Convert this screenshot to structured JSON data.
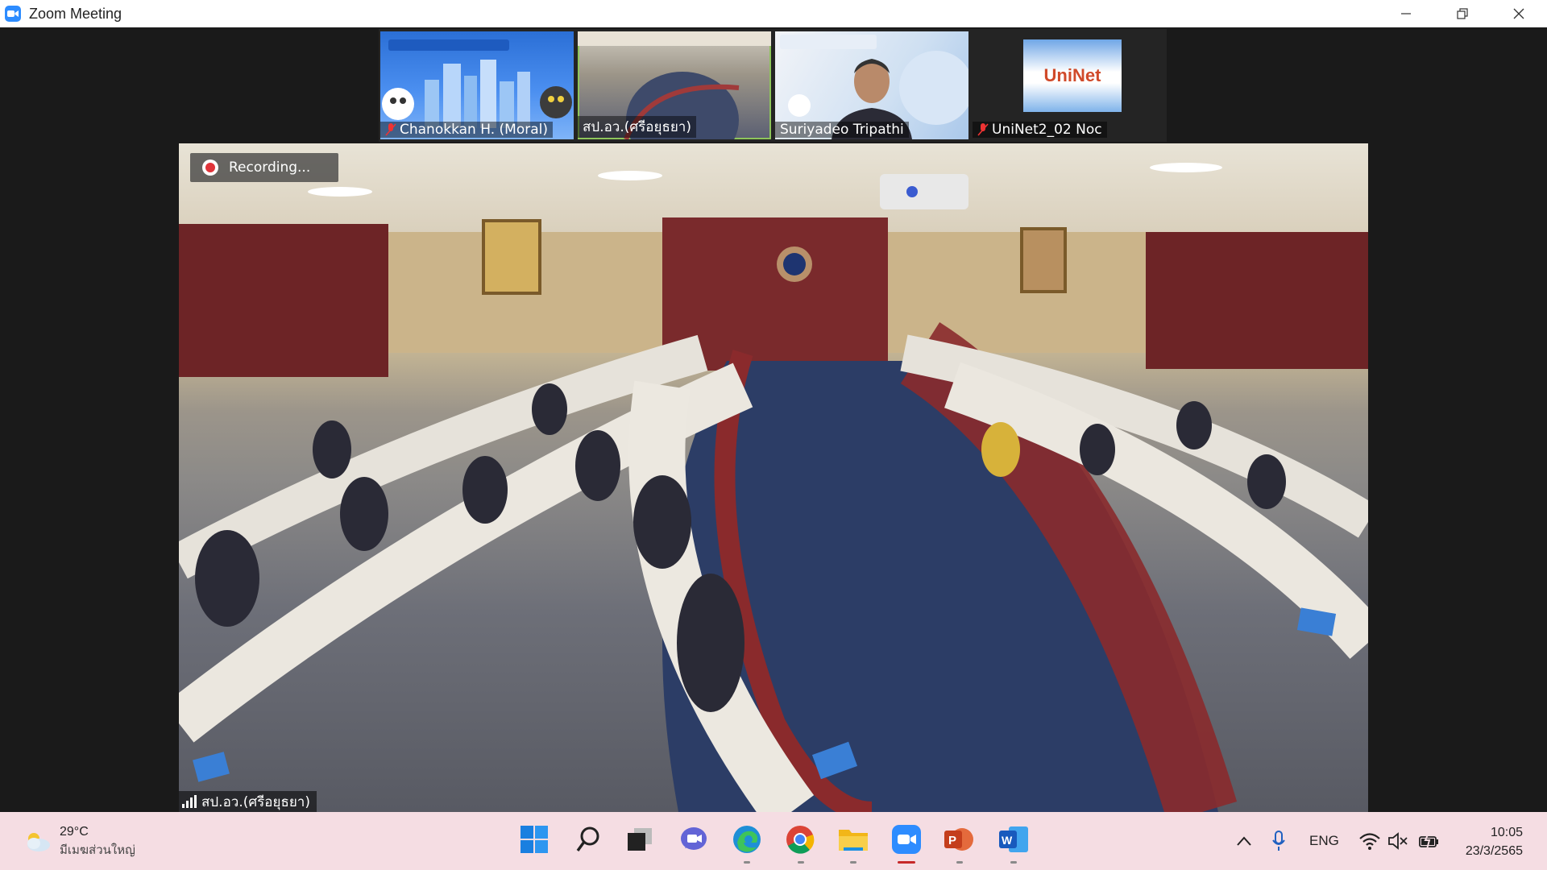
{
  "window": {
    "title": "Zoom Meeting",
    "controls": [
      "minimize",
      "restore",
      "close"
    ]
  },
  "gallery": {
    "participants": [
      {
        "name": "Chanokkan H. (Moral)",
        "muted": true
      },
      {
        "name": "สป.อว.(ศรีอยุธยา)",
        "muted": false,
        "active": true
      },
      {
        "name": "Suriyadeo Tripathi",
        "muted": false
      },
      {
        "name": "UniNet2_02 Noc",
        "muted": true,
        "logo_text": "UniNet"
      }
    ]
  },
  "main_video": {
    "recording_label": "Recording...",
    "speaker_name": "สป.อว.(ศรีอยุธยา)"
  },
  "taskbar": {
    "weather": {
      "temp": "29°C",
      "condition": "มีเมฆส่วนใหญ่"
    },
    "apps": [
      "start-icon",
      "search-icon",
      "task-view-icon",
      "teams-chat-icon",
      "edge-icon",
      "chrome-icon",
      "file-explorer-icon",
      "zoom-icon",
      "powerpoint-icon",
      "word-icon"
    ],
    "language": "ENG",
    "time": "10:05",
    "date": "23/3/2565"
  }
}
